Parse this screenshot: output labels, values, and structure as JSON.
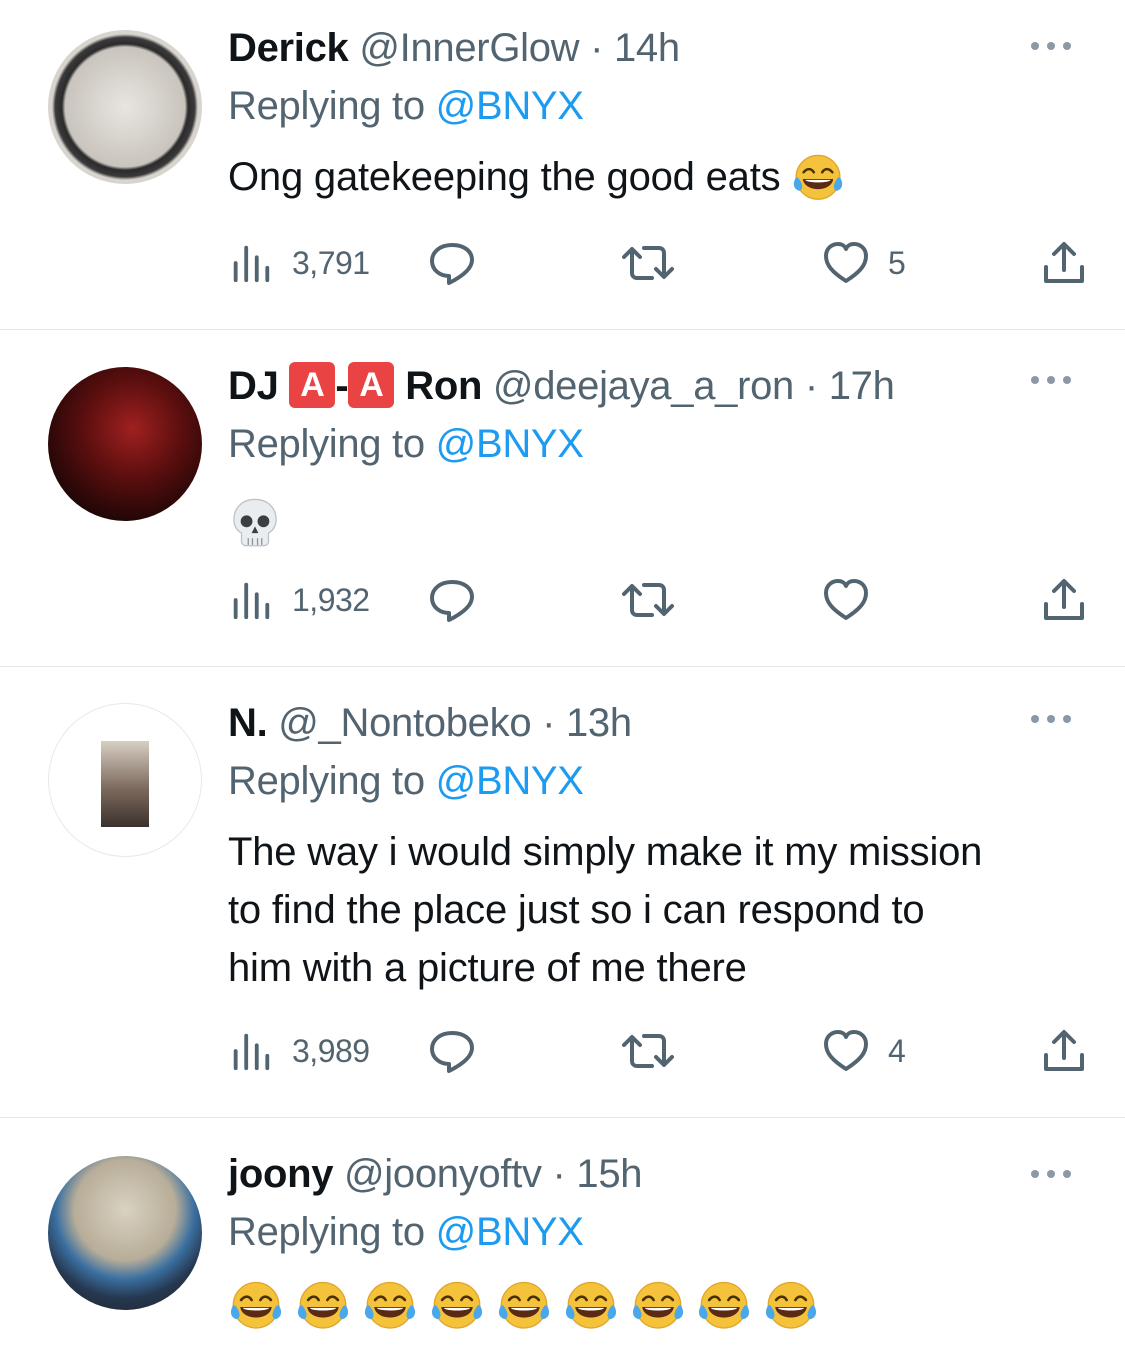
{
  "colors": {
    "accent": "#1d9bf0",
    "secondary_text": "#536471",
    "divider": "#e1e6ea"
  },
  "tweets": [
    {
      "name": "Derick",
      "handle": "@InnerGlow",
      "dot": "·",
      "time": "14h",
      "replying_prefix": "Replying to",
      "replying_to": "@BNYX",
      "text": "Ong gatekeeping the good eats",
      "views": "3,791",
      "likes": "5"
    },
    {
      "name_prefix": "DJ",
      "badge1": "A",
      "name_sep": "-",
      "badge2": "A",
      "name_suffix": "Ron",
      "handle": "@deejaya_a_ron",
      "dot": "·",
      "time": "17h",
      "replying_prefix": "Replying to",
      "replying_to": "@BNYX",
      "views": "1,932"
    },
    {
      "name": "N.",
      "handle": "@_Nontobeko",
      "dot": "·",
      "time": "13h",
      "replying_prefix": "Replying to",
      "replying_to": "@BNYX",
      "text_line1": "The way i would simply make it my mission",
      "text_line2": "to find the place just so i can respond to",
      "text_line3": "him with a picture of me there",
      "views": "3,989",
      "likes": "4"
    },
    {
      "name": "joony",
      "handle": "@joonyoftv",
      "dot": "·",
      "time": "15h",
      "replying_prefix": "Replying to",
      "replying_to": "@BNYX"
    }
  ],
  "icons": {
    "views": "views-icon",
    "reply": "reply-icon",
    "retweet": "retweet-icon",
    "like": "heart-icon",
    "share": "share-icon",
    "more": "more-icon"
  }
}
